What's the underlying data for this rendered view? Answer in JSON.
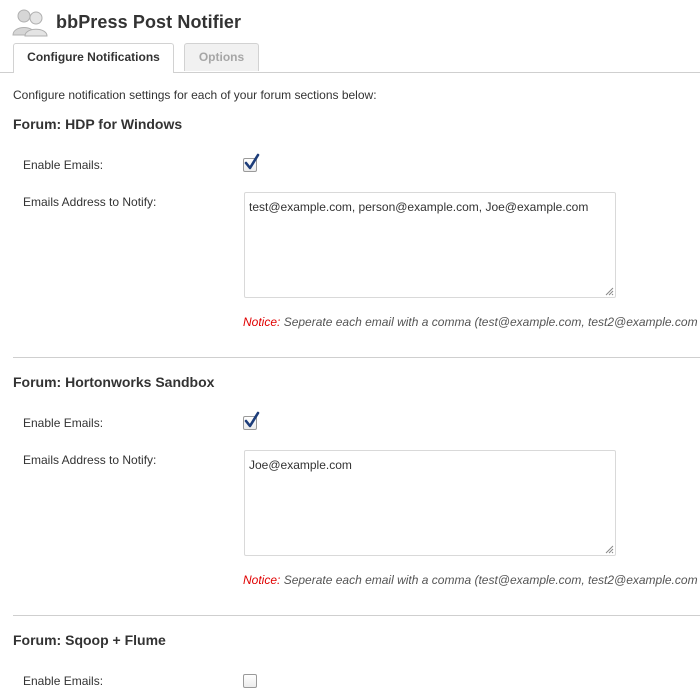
{
  "header": {
    "title": "bbPress Post Notifier",
    "logo_icon": "users-icon"
  },
  "tabs": [
    {
      "label": "Configure Notifications",
      "active": true
    },
    {
      "label": "Options",
      "active": false
    }
  ],
  "intro": "Configure notification settings for each of your forum sections below:",
  "forums": [
    {
      "title": "Forum: HDP for Windows",
      "enable_label": "Enable Emails:",
      "enabled": true,
      "emails_label": "Emails Address to Notify:",
      "emails_value": "test@example.com, person@example.com, Joe@example.com",
      "notice_label": "Notice:",
      "notice_text": " Seperate each email with a comma (test@example.com, test2@example.com"
    },
    {
      "title": "Forum: Hortonworks Sandbox",
      "enable_label": "Enable Emails:",
      "enabled": true,
      "emails_label": "Emails Address to Notify:",
      "emails_value": "Joe@example.com",
      "notice_label": "Notice:",
      "notice_text": " Seperate each email with a comma (test@example.com, test2@example.com"
    },
    {
      "title": "Forum: Sqoop + Flume",
      "enable_label": "Enable Emails:",
      "enabled": false
    }
  ],
  "colors": {
    "notice": "#e00000",
    "checkmark": "#1d3d7a",
    "divider": "#cfcfcf"
  }
}
